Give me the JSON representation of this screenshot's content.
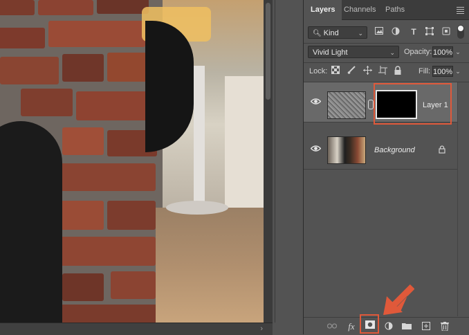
{
  "panel": {
    "tabs": [
      "Layers",
      "Channels",
      "Paths"
    ],
    "menu_icon": "panel-menu-icon"
  },
  "filter": {
    "kind_value": "Kind",
    "icons": [
      "image-filter-icon",
      "adjustment-filter-icon",
      "type-filter-icon",
      "shape-filter-icon",
      "smart-object-filter-icon"
    ]
  },
  "blend": {
    "mode": "Vivid Light",
    "opacity_label": "Opacity:",
    "opacity_value": "100%"
  },
  "lock": {
    "label": "Lock:",
    "fill_label": "Fill:",
    "fill_value": "100%",
    "icons": [
      "lock-transparent-icon",
      "lock-pixels-icon",
      "lock-position-icon",
      "lock-artboard-icon",
      "lock-all-icon"
    ]
  },
  "layers": [
    {
      "name": "Layer 1",
      "selected": true,
      "has_mask": true,
      "locked": false
    },
    {
      "name": "Background",
      "selected": false,
      "has_mask": false,
      "locked": true
    }
  ],
  "bottom_icons": [
    "link-layers-icon",
    "fx-icon",
    "add-mask-icon",
    "adjustment-layer-icon",
    "new-group-icon",
    "new-layer-icon",
    "delete-layer-icon"
  ],
  "colors": {
    "highlight": "#e0593a",
    "panel_bg": "#535353",
    "selected_row": "#696969"
  }
}
